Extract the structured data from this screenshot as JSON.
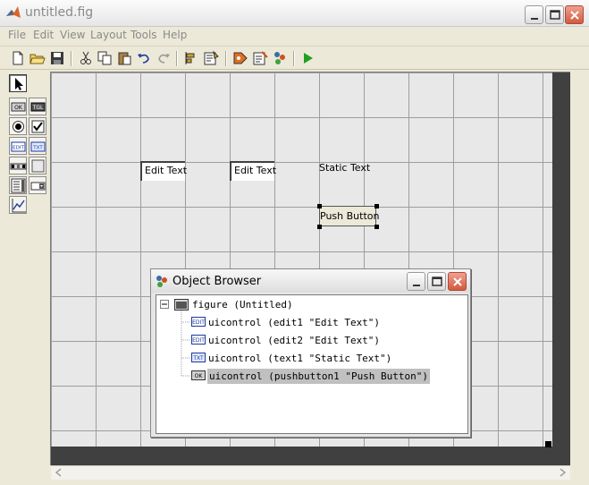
{
  "window": {
    "title": "untitled.fig"
  },
  "menu": [
    "File",
    "Edit",
    "View",
    "Layout",
    "Tools",
    "Help"
  ],
  "toolbar": [
    "new-file-icon",
    "open-folder-icon",
    "save-icon",
    "cut-icon",
    "copy-icon",
    "paste-icon",
    "undo-icon",
    "redo-icon",
    "align-icon",
    "menu-editor-icon",
    "tab-order-icon",
    "mfile-editor-icon",
    "property-inspector-icon",
    "object-browser-icon",
    "run-icon"
  ],
  "palette": [
    {
      "name": "select-tool-icon",
      "label": ""
    },
    {
      "name": "push-button-tool-icon",
      "label": "OK"
    },
    {
      "name": "toggle-button-tool-icon",
      "label": "TGL"
    },
    {
      "name": "radio-button-tool-icon",
      "label": ""
    },
    {
      "name": "checkbox-tool-icon",
      "label": ""
    },
    {
      "name": "edit-text-tool-icon",
      "label": "EDIT"
    },
    {
      "name": "static-text-tool-icon",
      "label": "TXT"
    },
    {
      "name": "slider-tool-icon",
      "label": ""
    },
    {
      "name": "frame-tool-icon",
      "label": ""
    },
    {
      "name": "listbox-tool-icon",
      "label": ""
    },
    {
      "name": "popup-menu-tool-icon",
      "label": ""
    },
    {
      "name": "axes-tool-icon",
      "label": ""
    }
  ],
  "canvas": {
    "edit1": "Edit Text",
    "edit2": "Edit Text",
    "static": "Static Text",
    "push": "Push Button"
  },
  "object_browser": {
    "title": "Object Browser",
    "root": "figure (Untitled)",
    "items": [
      {
        "icon": "edit-text-icon",
        "label": "uicontrol (edit1 \"Edit Text\")"
      },
      {
        "icon": "edit-text-icon",
        "label": "uicontrol (edit2 \"Edit Text\")"
      },
      {
        "icon": "static-text-icon",
        "label": "uicontrol (text1 \"Static Text\")"
      },
      {
        "icon": "push-button-icon",
        "label": "uicontrol (pushbutton1 \"Push Button\")",
        "selected": true
      }
    ]
  }
}
